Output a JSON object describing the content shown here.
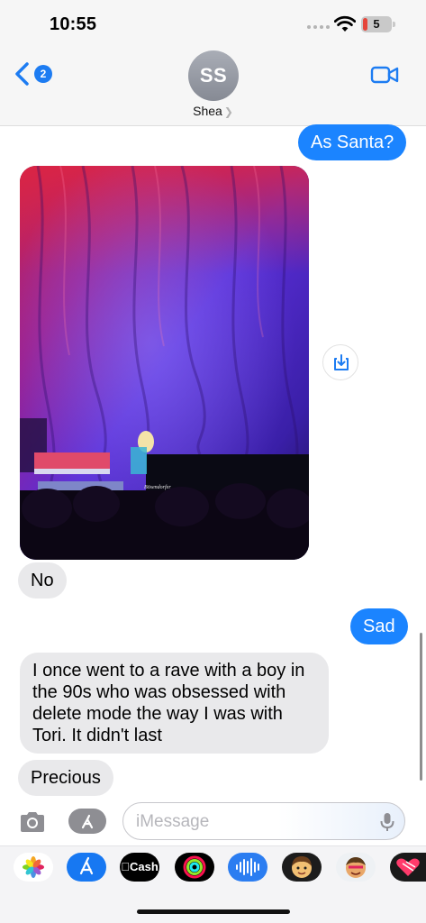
{
  "status": {
    "time": "10:55",
    "battery": "5"
  },
  "header": {
    "back_badge": "2",
    "avatar_initials": "SS",
    "contact_name": "Shea",
    "icons": {
      "back": "chevron-left-icon",
      "video": "video-camera-icon"
    }
  },
  "messages": [
    {
      "type": "sent",
      "text": "As Santa?"
    },
    {
      "type": "received-photo",
      "caption": "Bösendorfer"
    },
    {
      "type": "received",
      "text": "No"
    },
    {
      "type": "sent",
      "text": "Sad"
    },
    {
      "type": "received",
      "text_lines": [
        "I once went to a rave with a boy in",
        "the 90s who was obsessed with",
        "delete mode the way I was with",
        "Tori. It didn't last"
      ]
    },
    {
      "type": "received",
      "text": "Precious"
    }
  ],
  "composer": {
    "placeholder": "iMessage",
    "icons": [
      "camera-icon",
      "apps-icon",
      "microphone-icon"
    ]
  },
  "app_drawer": {
    "cash_label": "Cash",
    "apps": [
      "photos-icon",
      "app-store-icon",
      "apple-cash-icon",
      "fitness-icon",
      "audio-message-icon",
      "memoji-icon",
      "memoji-stickers-icon",
      "digital-touch-icon"
    ]
  },
  "colors": {
    "sent_bubble": "#1b84ff",
    "received_bubble": "#e9e9eb",
    "accent": "#1d7cf2"
  }
}
